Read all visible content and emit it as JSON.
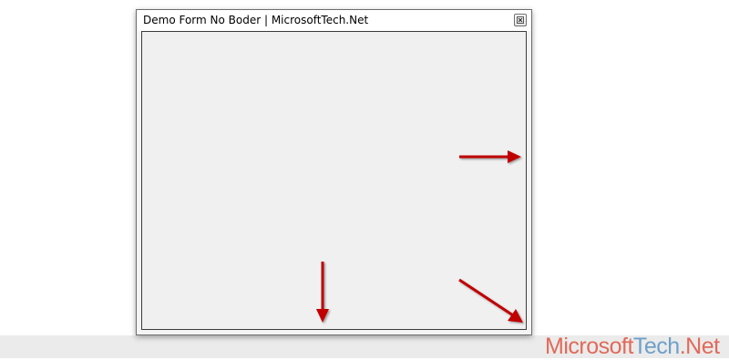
{
  "window": {
    "title": "Demo Form No Boder | MicrosoftTech.Net"
  },
  "titlebar_buttons": {
    "close_icon": "close-icon"
  },
  "annotations": {
    "arrow_color": "#c00000",
    "arrows": [
      "arrow-right-edge",
      "arrow-bottom-edge",
      "arrow-bottom-right-corner"
    ]
  },
  "watermark": {
    "text": "MicrosoftTech.Net",
    "part1": "Microsoft",
    "part2": "Tech",
    "part3": ".Net",
    "colors": {
      "part1": "#e06a5a",
      "part2": "#6fa0c8",
      "part3": "#e06a5a"
    }
  },
  "colors": {
    "client_background": "#f0f0f0",
    "strip_background": "#ebebeb"
  }
}
